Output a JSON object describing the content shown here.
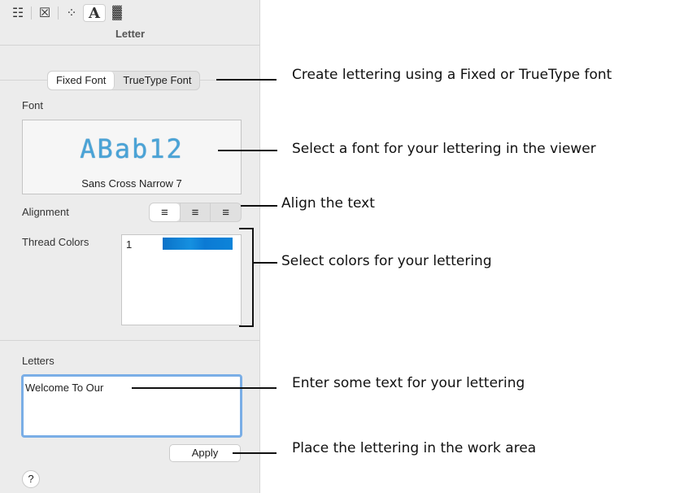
{
  "toolbar": {
    "tools": [
      {
        "icon": "properties-list-icon",
        "glyph": "☷"
      },
      {
        "icon": "cross-stitch-icon",
        "glyph": "☒"
      },
      {
        "icon": "dotted-circle-icon",
        "glyph": "⁘"
      },
      {
        "icon": "letter-a-icon",
        "glyph": "A"
      },
      {
        "icon": "fill-pattern-icon",
        "glyph": "▓"
      }
    ],
    "active_tool": "letter-a-icon"
  },
  "panel": {
    "title": "Letter",
    "font_type_tabs": [
      "Fixed Font",
      "TrueType Font"
    ],
    "selected_font_type": "Fixed Font",
    "font_label": "Font",
    "font_sample": "ABab12",
    "font_name": "Sans Cross Narrow 7",
    "alignment_label": "Alignment",
    "alignment_options": [
      "left",
      "center",
      "right"
    ],
    "selected_alignment": "left",
    "thread_colors_label": "Thread Colors",
    "thread_colors": [
      {
        "index": "1",
        "color": "#1590e0"
      }
    ],
    "letters_label": "Letters",
    "letters_value": "Welcome To Our",
    "apply_label": "Apply",
    "help_label": "?"
  },
  "callouts": {
    "font_type": "Create lettering using a Fixed or TrueType font",
    "viewer": "Select a font for your lettering in the viewer",
    "align": "Align the text",
    "colors": "Select colors for your lettering",
    "text": "Enter some text for your lettering",
    "apply": "Place the lettering in the work area"
  }
}
